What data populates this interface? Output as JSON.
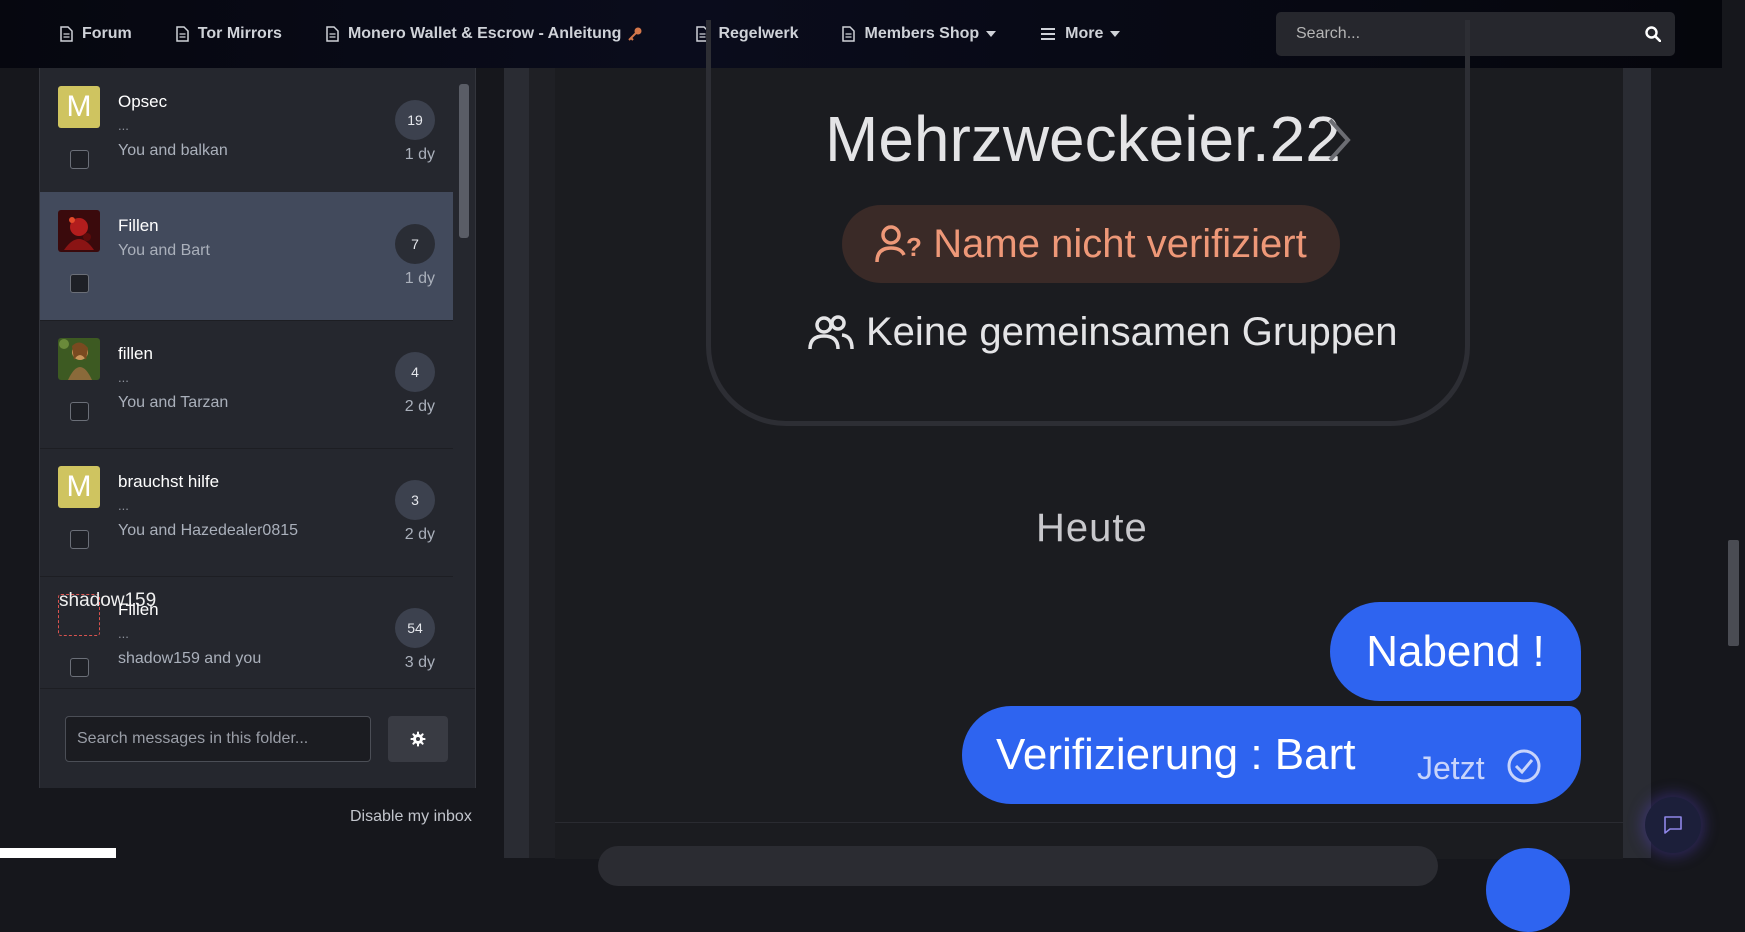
{
  "nav": {
    "items": [
      {
        "label": "Forum",
        "icon": "file-icon"
      },
      {
        "label": "Tor Mirrors",
        "icon": "file-icon"
      },
      {
        "label": "Monero Wallet & Escrow - Anleitung",
        "icon": "file-icon"
      },
      {
        "label": "Regelwerk",
        "icon": "file-icon"
      },
      {
        "label": "Members Shop",
        "icon": "file-icon"
      },
      {
        "label": "More",
        "icon": "menu-icon"
      }
    ],
    "search_placeholder": "Search..."
  },
  "conversations": [
    {
      "title": "Opsec",
      "dots": "...",
      "participants": "You and balkan",
      "count": "19",
      "time": "1 dy",
      "avatar": "M"
    },
    {
      "title": "Fillen",
      "dots": "",
      "participants": "You and Bart",
      "count": "7",
      "time": "1 dy",
      "avatar": "image"
    },
    {
      "title": "fillen",
      "dots": "...",
      "participants": "You and Tarzan",
      "count": "4",
      "time": "2 dy",
      "avatar": "image"
    },
    {
      "title": "brauchst hilfe",
      "dots": "...",
      "participants": "You and Hazedealer0815",
      "count": "3",
      "time": "2 dy",
      "avatar": "M"
    },
    {
      "title": "Fillen",
      "dots": "...",
      "participants": "shadow159 and you",
      "count": "54",
      "time": "3 dy",
      "avatar_alt": "shadow159"
    }
  ],
  "folder_search_placeholder": "Search messages in this folder...",
  "disable_inbox_label": "Disable my inbox",
  "screenshot": {
    "profile_name": "Mehrzweckeier.22",
    "unverified_label": "Name nicht verifiziert",
    "groups_label": "Keine gemeinsamen Gruppen",
    "day_separator": "Heute",
    "messages": [
      {
        "text": "Nabend !"
      },
      {
        "text": "Verifizierung : Bart",
        "time": "Jetzt"
      }
    ]
  },
  "colors": {
    "bubble": "#2e64f0",
    "unverified": "#ee9878",
    "avatar_letter_bg": "#cfc460",
    "active_row": "#424a5c"
  }
}
